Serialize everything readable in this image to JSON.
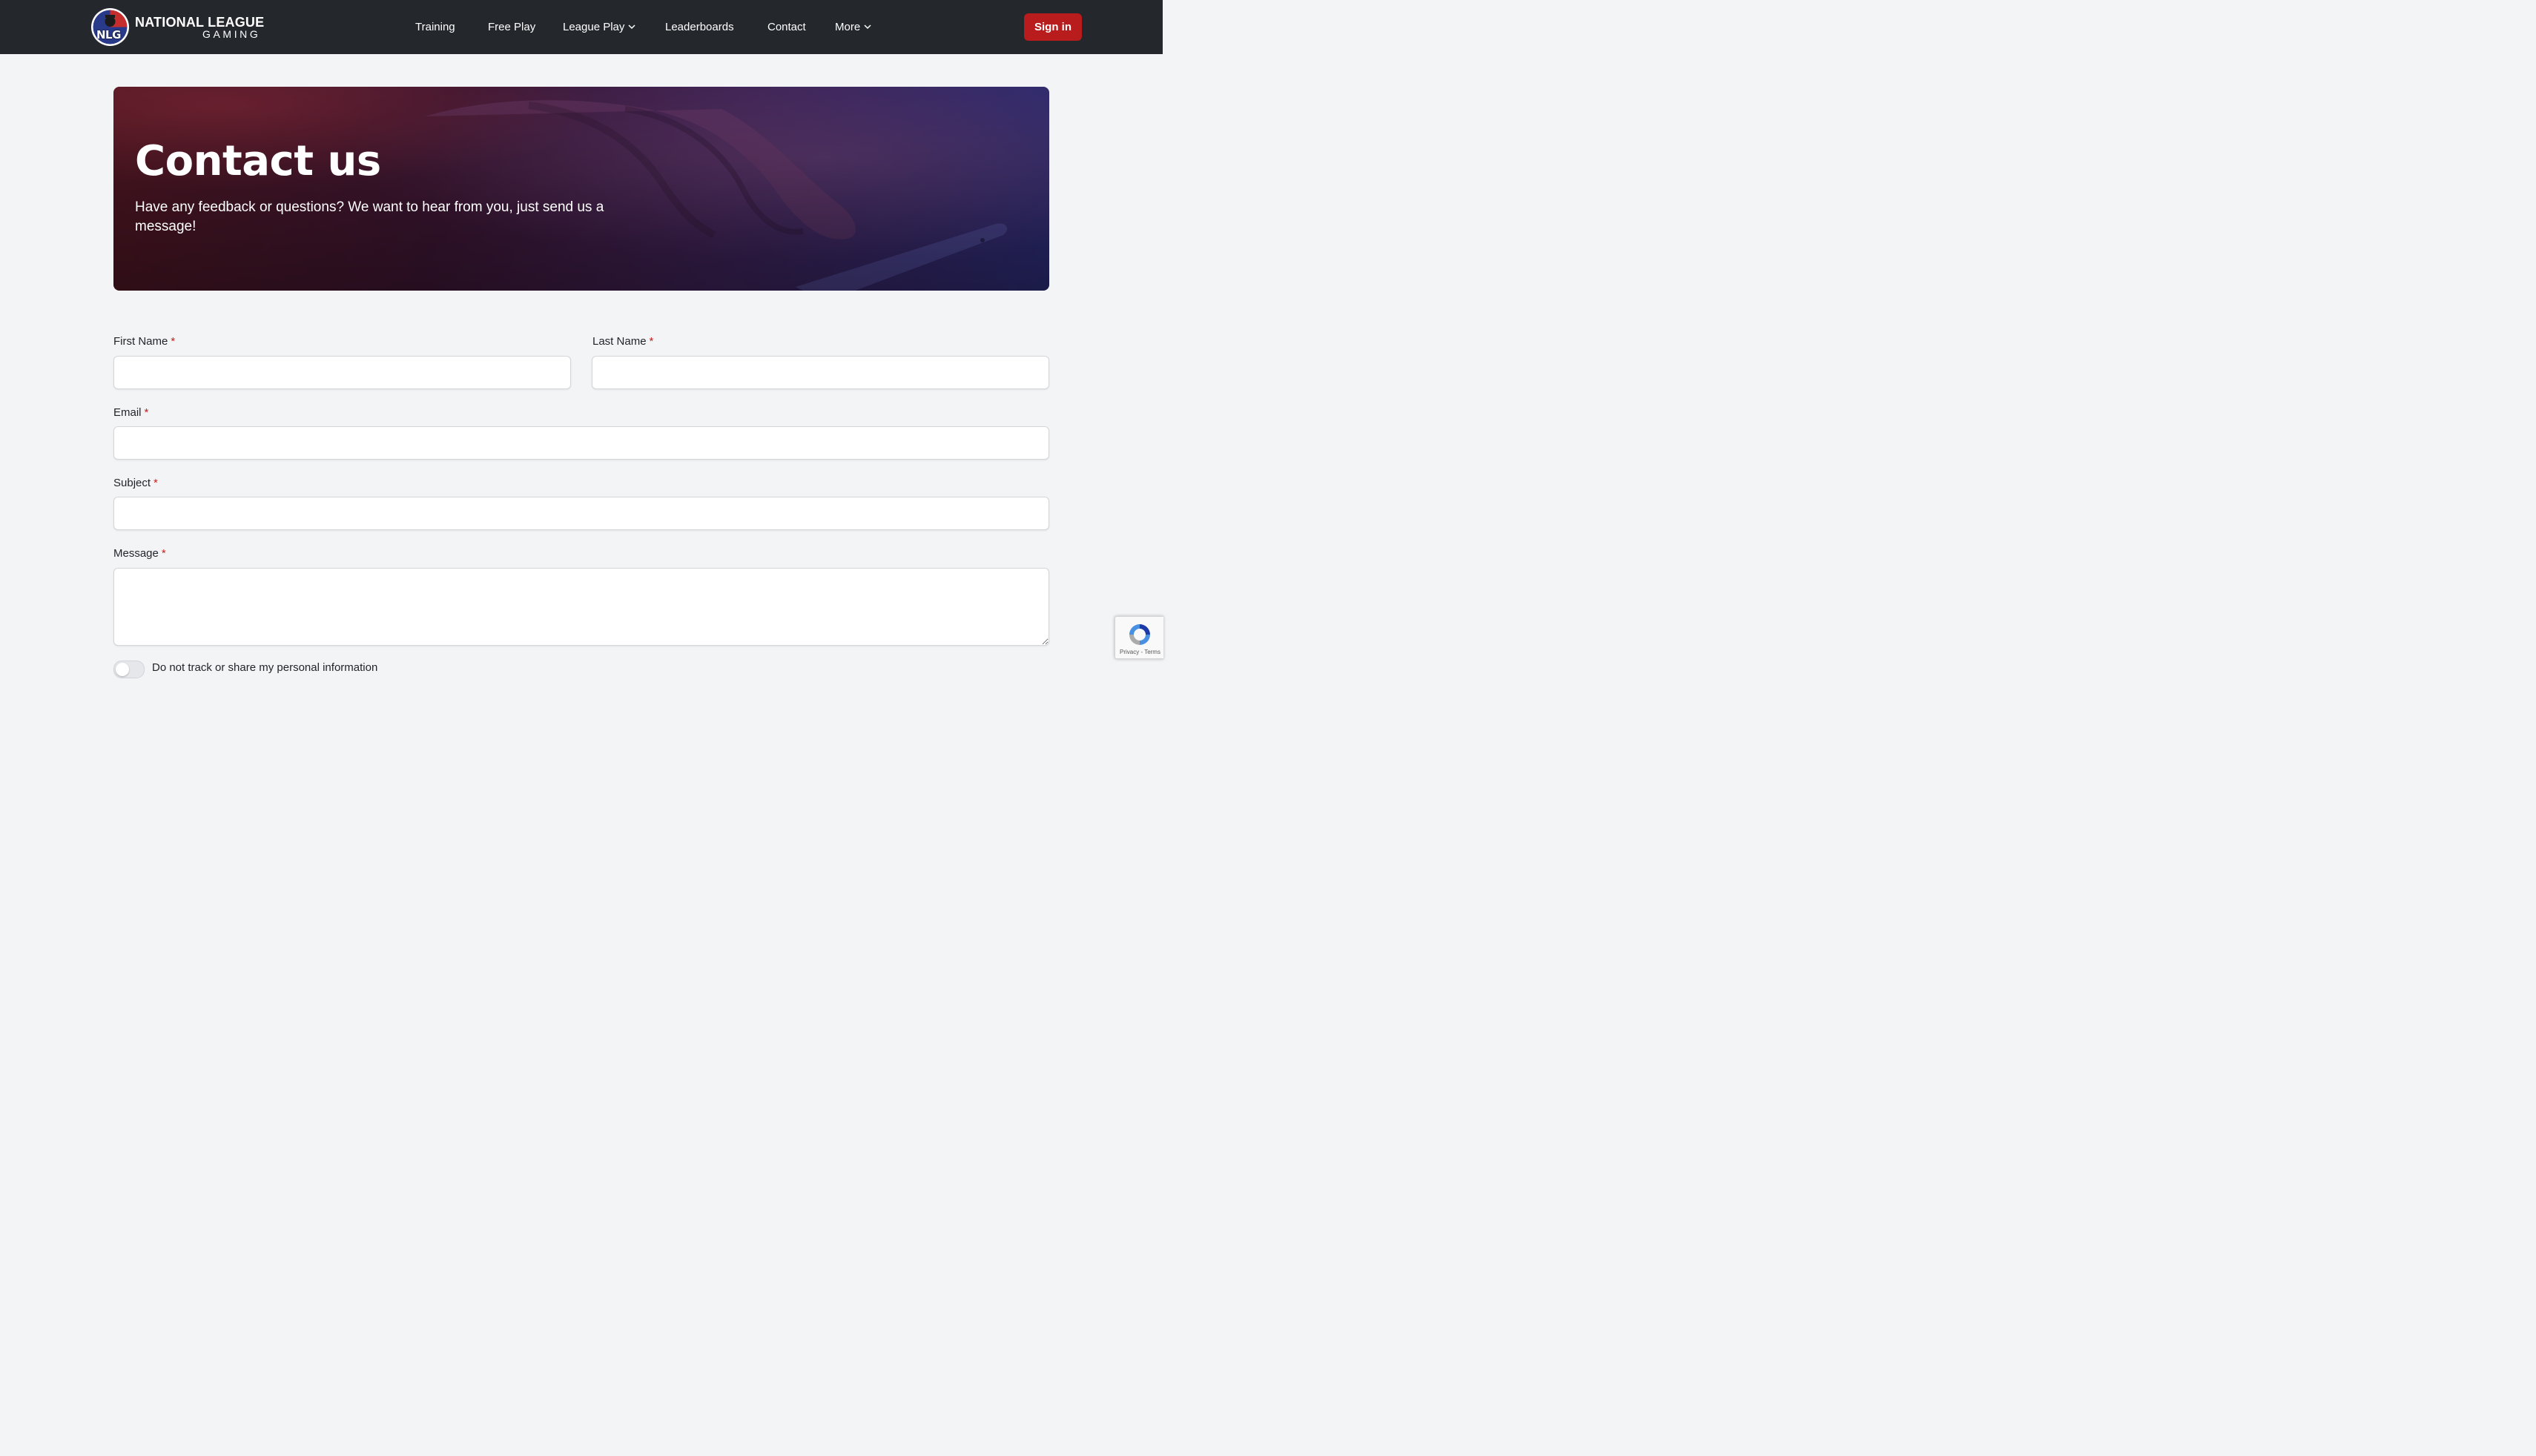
{
  "nav": {
    "brand_line1": "NATIONAL LEAGUE",
    "brand_line2": "GAMING",
    "badge_text": "NLG",
    "items": [
      {
        "label": "Training"
      },
      {
        "label": "Free Play"
      },
      {
        "label": "League Play"
      },
      {
        "label": "Leaderboards"
      },
      {
        "label": "Contact"
      },
      {
        "label": "More"
      }
    ],
    "signin_label": "Sign in"
  },
  "hero": {
    "title": "Contact us",
    "subtitle": "Have any feedback or questions? We want to hear from you, just send us a message!"
  },
  "form": {
    "required_mark": "*",
    "first_name_label": "First Name",
    "last_name_label": "Last Name",
    "email_label": "Email",
    "subject_label": "Subject",
    "message_label": "Message",
    "toggle_label": "Do not track or share my personal information"
  },
  "recaptcha": {
    "links": "Privacy - Terms"
  },
  "colors": {
    "topbar": "#24272c",
    "accent": "#b91c1c",
    "background": "#f3f4f6"
  }
}
